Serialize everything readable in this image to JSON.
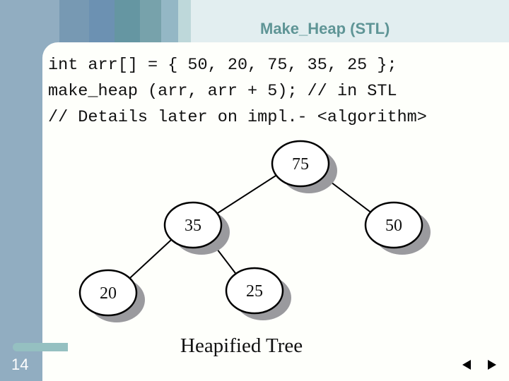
{
  "slide": {
    "title": "Make_Heap (STL)",
    "number": "14",
    "code_lines": [
      "int arr[] = { 50, 20, 75, 35, 25 };",
      "make_heap (arr, arr + 5); // in STL",
      "// Details later on impl.- <algorithm>"
    ],
    "caption": "Heapified Tree"
  },
  "tree": {
    "nodes": [
      {
        "id": "n75",
        "label": "75",
        "level": 0,
        "parent": null
      },
      {
        "id": "n35",
        "label": "35",
        "level": 1,
        "parent": "n75"
      },
      {
        "id": "n50",
        "label": "50",
        "level": 1,
        "parent": "n75"
      },
      {
        "id": "n20",
        "label": "20",
        "level": 2,
        "parent": "n35"
      },
      {
        "id": "n25",
        "label": "25",
        "level": 2,
        "parent": "n35"
      }
    ]
  },
  "navigation": {
    "prev_icon": "triangle-left-icon",
    "next_icon": "triangle-right-icon"
  },
  "colors": {
    "sidebar": "#91adc1",
    "title": "#5f9596",
    "top_bands": [
      "#91adc1",
      "#7799b3",
      "#6c91b2",
      "#6596a2",
      "#77a2ab",
      "#94b7c5",
      "#bed8da",
      "#e2eef0"
    ],
    "pill": "#95c0c1",
    "shadow": "#9a9a9e"
  }
}
